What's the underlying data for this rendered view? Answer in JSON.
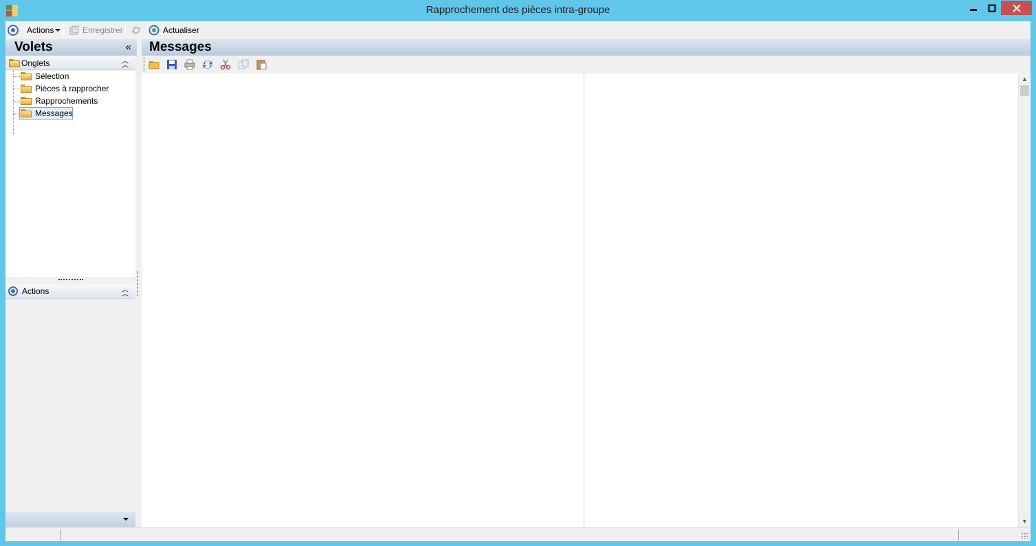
{
  "window": {
    "title": "Rapprochement des pièces intra-groupe",
    "controls": {
      "minimize": "—",
      "maximize": "☐",
      "close": "✕"
    }
  },
  "toolbar": {
    "actions_label": "Actions",
    "save_label": "Enregistrer",
    "refresh_label": "Actualiser"
  },
  "left_panel": {
    "title": "Volets",
    "collapse_glyph": "«",
    "onglets": {
      "label": "Onglets",
      "items": [
        {
          "label": "Sélection",
          "selected": false
        },
        {
          "label": "Pièces à rapprocher",
          "selected": false
        },
        {
          "label": "Rapprochements",
          "selected": false
        },
        {
          "label": "Messages",
          "selected": true
        }
      ]
    },
    "actions": {
      "label": "Actions"
    }
  },
  "main_panel": {
    "title": "Messages",
    "toolbar_icons": [
      "open-folder-icon",
      "save-icon",
      "print-icon",
      "refresh-icon",
      "cut-icon",
      "copy-icon",
      "paste-icon"
    ]
  },
  "colors": {
    "titlebar": "#61c7ea",
    "close_button": "#c75050",
    "header_gradient": "#b9cadc",
    "accent": "#3f6fb6"
  }
}
